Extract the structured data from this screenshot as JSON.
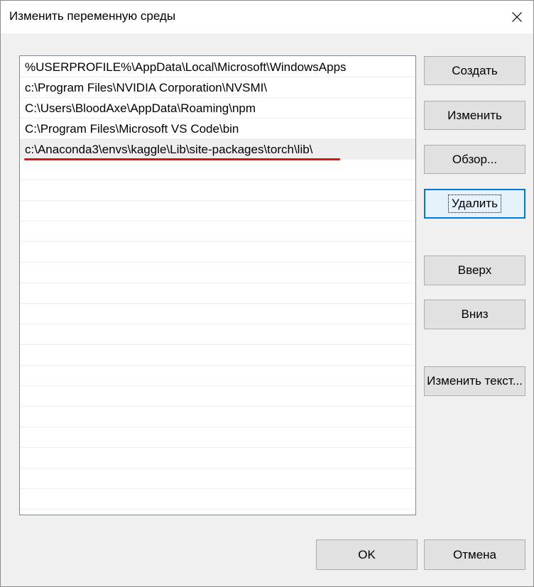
{
  "window": {
    "title": "Изменить переменную среды"
  },
  "list": {
    "items": [
      "%USERPROFILE%\\AppData\\Local\\Microsoft\\WindowsApps",
      "c:\\Program Files\\NVIDIA Corporation\\NVSMI\\",
      "C:\\Users\\BloodAxe\\AppData\\Roaming\\npm",
      "C:\\Program Files\\Microsoft VS Code\\bin",
      "c:\\Anaconda3\\envs\\kaggle\\Lib\\site-packages\\torch\\lib\\"
    ],
    "selected_index": 4
  },
  "buttons": {
    "create": "Создать",
    "edit": "Изменить",
    "browse": "Обзор...",
    "delete": "Удалить",
    "up": "Вверх",
    "down": "Вниз",
    "edit_text": "Изменить текст...",
    "ok": "OK",
    "cancel": "Отмена"
  },
  "colors": {
    "annotation_underline": "#e3101c",
    "focus_border": "#0078d7"
  }
}
